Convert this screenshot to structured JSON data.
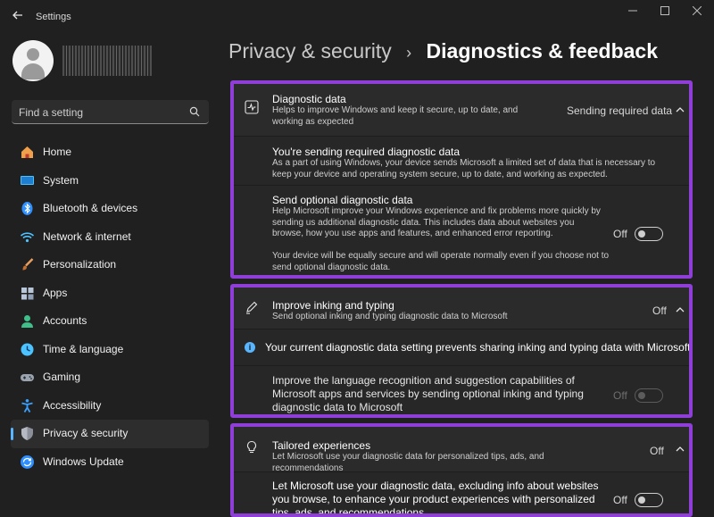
{
  "window": {
    "title": "Settings",
    "back_icon": "arrow-left-icon"
  },
  "sidebar": {
    "search": {
      "placeholder": "Find a setting",
      "value": ""
    },
    "items": [
      {
        "label": "Home",
        "icon": "home-icon",
        "color": "#f0a04b"
      },
      {
        "label": "System",
        "icon": "monitor-icon",
        "color": "#4cc2ff"
      },
      {
        "label": "Bluetooth & devices",
        "icon": "bluetooth-icon",
        "color": "#2f8fff"
      },
      {
        "label": "Network & internet",
        "icon": "wifi-icon",
        "color": "#4cc2ff"
      },
      {
        "label": "Personalization",
        "icon": "brush-icon",
        "color": "#e8a060"
      },
      {
        "label": "Apps",
        "icon": "apps-icon",
        "color": "#b8c6d8"
      },
      {
        "label": "Accounts",
        "icon": "person-icon",
        "color": "#3fbf8a"
      },
      {
        "label": "Time & language",
        "icon": "globe-clock-icon",
        "color": "#4cc2ff"
      },
      {
        "label": "Gaming",
        "icon": "gamepad-icon",
        "color": "#9aa4b0"
      },
      {
        "label": "Accessibility",
        "icon": "accessibility-icon",
        "color": "#3aa0ff"
      },
      {
        "label": "Privacy & security",
        "icon": "shield-icon",
        "color": "#8a8f99",
        "active": true
      },
      {
        "label": "Windows Update",
        "icon": "update-icon",
        "color": "#2f8fff"
      }
    ]
  },
  "breadcrumb": {
    "parent": "Privacy & security",
    "separator": "›",
    "current": "Diagnostics & feedback"
  },
  "sections": {
    "diagnostic": {
      "title": "Diagnostic data",
      "description": "Helps to improve Windows and keep it secure, up to date, and working as expected",
      "status": "Sending required data",
      "required": {
        "title": "You're sending required diagnostic data",
        "description": "As a part of using Windows, your device sends Microsoft a limited set of data that is necessary to keep your device and operating system secure, up to date, and working as expected."
      },
      "optional": {
        "title": "Send optional diagnostic data",
        "description": "Help Microsoft improve your Windows experience and fix problems more quickly by sending us additional diagnostic data. This includes data about websites you browse, how you use apps and features, and enhanced error reporting.",
        "note": "Your device will be equally secure and will operate normally even if you choose not to send optional diagnostic data.",
        "toggle_label": "Off"
      }
    },
    "inking": {
      "title": "Improve inking and typing",
      "description": "Send optional inking and typing diagnostic data to Microsoft",
      "status": "Off",
      "info": "Your current diagnostic data setting prevents sharing inking and typing data with Microsoft.",
      "detail": "Improve the language recognition and suggestion capabilities of Microsoft apps and services by sending optional inking and typing diagnostic data to Microsoft",
      "toggle_label": "Off"
    },
    "tailored": {
      "title": "Tailored experiences",
      "description": "Let Microsoft use your diagnostic data for personalized tips, ads, and recommendations",
      "status": "Off",
      "detail": "Let Microsoft use your diagnostic data, excluding info about websites you browse, to enhance your product experiences with personalized tips, ads, and recommendations",
      "toggle_label": "Off"
    }
  },
  "colors": {
    "accent": "#5ab5ff",
    "highlight_border": "#8f3fd8"
  }
}
